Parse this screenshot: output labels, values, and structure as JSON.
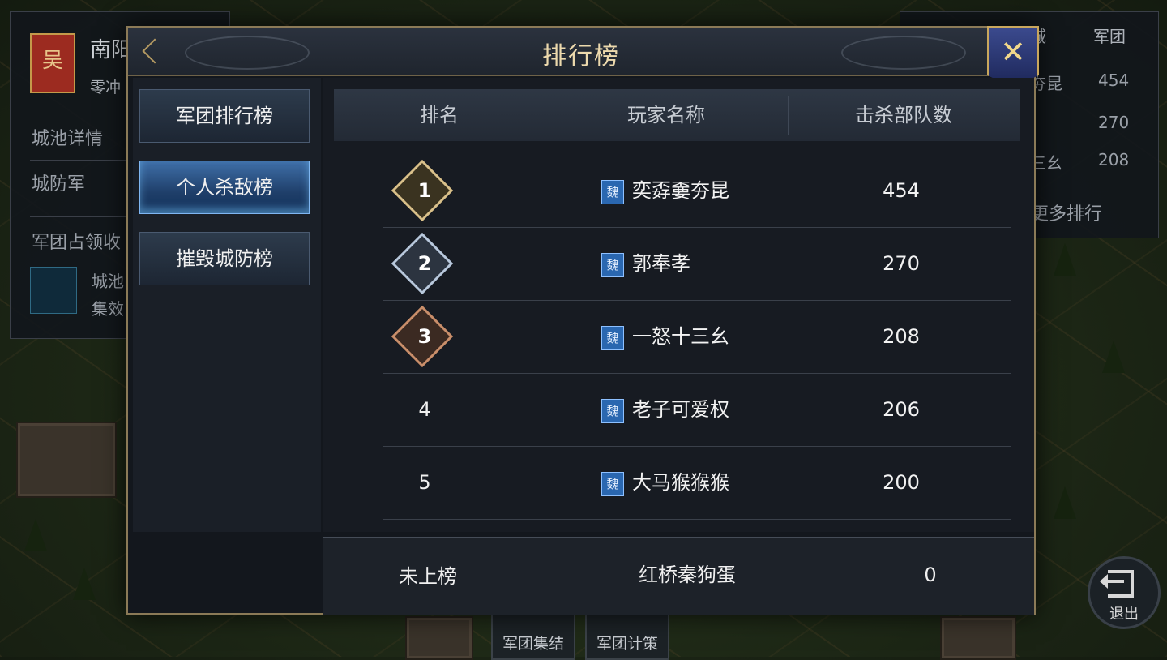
{
  "background": {
    "left_panel": {
      "banner_char": "吴",
      "title": "南阳",
      "subtitle": "零冲",
      "items": [
        "城池详情",
        "城防军",
        "军团占领收"
      ],
      "icon_text": [
        "城池",
        "集效"
      ]
    },
    "right_panel": {
      "headers": [
        "城",
        "军团"
      ],
      "rows": [
        {
          "name": "夯昆",
          "value": "454"
        },
        {
          "name": "",
          "value": "270"
        },
        {
          "name": "三幺",
          "value": "208"
        }
      ],
      "more": "更多排行"
    },
    "bottom_buttons": [
      "军团集结",
      "军团计策"
    ],
    "exit_label": "退出"
  },
  "dialog": {
    "title": "排行榜",
    "close_icon": "crossed-swords-close-icon",
    "tabs": [
      {
        "label": "军团排行榜",
        "active": false
      },
      {
        "label": "个人杀敌榜",
        "active": true
      },
      {
        "label": "摧毁城防榜",
        "active": false
      }
    ],
    "columns": [
      "排名",
      "玩家名称",
      "击杀部队数"
    ],
    "rows": [
      {
        "rank": "1",
        "faction": "魏",
        "name": "奕孬嫑夯昆",
        "kills": "454"
      },
      {
        "rank": "2",
        "faction": "魏",
        "name": "郭奉孝",
        "kills": "270"
      },
      {
        "rank": "3",
        "faction": "魏",
        "name": "一怒十三幺",
        "kills": "208"
      },
      {
        "rank": "4",
        "faction": "魏",
        "name": "老子可爱权",
        "kills": "206"
      },
      {
        "rank": "5",
        "faction": "魏",
        "name": "大马猴猴猴",
        "kills": "200"
      }
    ],
    "self": {
      "rank": "未上榜",
      "name": "红桥秦狗蛋",
      "kills": "0"
    }
  }
}
